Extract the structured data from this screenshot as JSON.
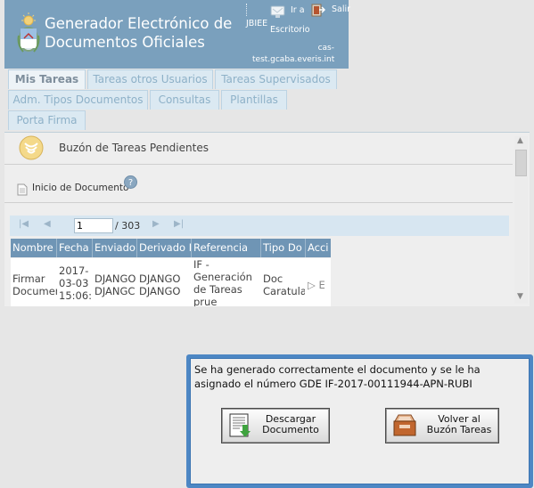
{
  "header": {
    "title_line1": "Generador Electrónico de",
    "title_line2": "Documentos Oficiales",
    "user": "JBIEE",
    "link_escritorio_1": "Ir a",
    "link_escritorio_2": "Escritorio",
    "link_salir": "Salir",
    "server_1": "cas-",
    "server_2": "test.gcaba.everis.int"
  },
  "tabs": [
    {
      "label": "Mis Tareas"
    },
    {
      "label": "Tareas otros Usuarios"
    },
    {
      "label": "Tareas Supervisados"
    },
    {
      "label": "Adm. Tipos Documentos"
    },
    {
      "label": "Consultas"
    },
    {
      "label": "Plantillas"
    },
    {
      "label": "Porta Firma"
    }
  ],
  "panel": {
    "title": "Buzón de Tareas Pendientes",
    "action": "Inicio de Documento"
  },
  "pager": {
    "page": "1",
    "total": "/ 303"
  },
  "grid": {
    "columns": [
      "Nombre",
      "Fecha",
      "Enviado",
      "Derivado P",
      "Referencia",
      "Tipo Do",
      "Acci"
    ],
    "row": {
      "nombre_1": "Firmar",
      "nombre_2": "Documen",
      "fecha_1": "2017-",
      "fecha_2": "03-03",
      "fecha_3": "15:06:",
      "enviado_1": "DJANGO",
      "enviado_2": "DJANGC",
      "derivado_1": "DJANGO",
      "derivado_2": "DJANGO",
      "referencia_1": "IF -",
      "referencia_2": "Generación",
      "referencia_3": "de Tareas",
      "referencia_4": "prue",
      "tipo_1": "Doc",
      "tipo_2": "Caratula",
      "accion": "▷ E"
    }
  },
  "dialog": {
    "message": "Se ha generado correctamente el documento y se le ha asignado el número GDE IF-2017-00111944-APN-RUBI",
    "btn_descargar_1": "Descargar",
    "btn_descargar_2": "Documento",
    "btn_volver_1": "Volver al",
    "btn_volver_2": "Buzón Tareas"
  },
  "icons": {
    "logo": "argentina-coat-of-arms-icon",
    "escritorio": "desktop-icon",
    "salir": "exit-icon",
    "inbox": "inbox-icon",
    "document": "document-icon",
    "help": "help-icon",
    "download": "download-document-icon",
    "mailbox": "mailbox-tray-icon"
  },
  "colors": {
    "header_bg": "#7aa0bd",
    "grid_header_bg": "#6f95b5",
    "dialog_border": "#4d87c4"
  }
}
